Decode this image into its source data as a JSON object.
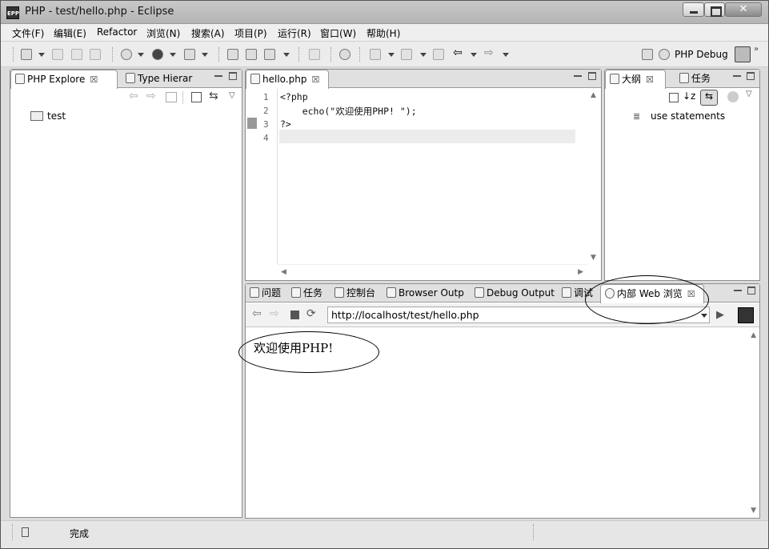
{
  "window": {
    "title": "PHP  -  test/hello.php  -  Eclipse",
    "app_icon": "EPP"
  },
  "menu": [
    "文件(F)",
    "编辑(E)",
    "Refactor",
    "浏览(N)",
    "搜索(A)",
    "项目(P)",
    "运行(R)",
    "窗口(W)",
    "帮助(H)"
  ],
  "perspective": {
    "label": "PHP Debug"
  },
  "left_panel": {
    "tabs": [
      {
        "label": "PHP Explore",
        "close": "☒"
      },
      {
        "label": "Type Hierar"
      }
    ],
    "tree": [
      {
        "label": "test"
      }
    ]
  },
  "editor": {
    "tab": {
      "label": "hello.php",
      "close": "☒"
    },
    "line_numbers": [
      "1",
      "2",
      "3",
      "4"
    ],
    "lines": [
      "<?php",
      "    echo(\"欢迎使用PHP! \");",
      "?>",
      ""
    ]
  },
  "outline_panel": {
    "tabs": [
      {
        "label": "大纲",
        "close": "☒"
      },
      {
        "label": "任务"
      }
    ],
    "items": [
      {
        "label": "use statements"
      }
    ]
  },
  "bottom_panel": {
    "tabs": [
      {
        "label": "问题"
      },
      {
        "label": "任务"
      },
      {
        "label": "控制台"
      },
      {
        "label": "Browser Outp"
      },
      {
        "label": "Debug Output"
      },
      {
        "label": "调试"
      },
      {
        "label": "内部 Web 浏览",
        "close": "☒",
        "active": true
      }
    ],
    "url": "http://localhost/test/hello.php",
    "content": "欢迎使用PHP!"
  },
  "status": {
    "text": "完成"
  }
}
